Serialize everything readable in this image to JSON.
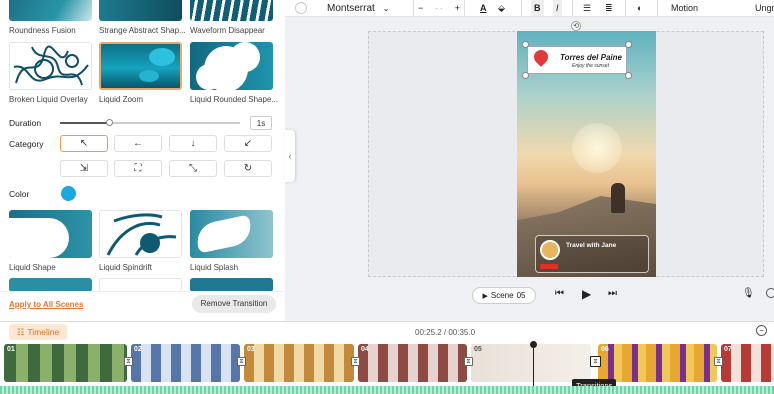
{
  "transitions": {
    "row1": [
      "Roundness Fusion",
      "Strange Abstract Shap...",
      "Waveform Disappear"
    ],
    "row2": [
      "Broken Liquid Overlay",
      "Liquid Zoom",
      "Liquid Rounded Shape..."
    ],
    "row3": [
      "Liquid Shape",
      "Liquid Spindrift",
      "Liquid Splash"
    ]
  },
  "duration": {
    "label": "Duration",
    "value": "1s",
    "fraction": 0.12
  },
  "category": {
    "label": "Category"
  },
  "color": {
    "label": "Color",
    "value": "#1aa8e0"
  },
  "actions": {
    "apply_all": "Apply to All Scenes",
    "remove": "Remove Transition"
  },
  "toolbar": {
    "font": "Montserrat",
    "size": "- -",
    "motion": "Motion",
    "group": "Ungr"
  },
  "preview": {
    "title": "Torres del Paine",
    "subtitle": "Enjoy the sunset",
    "badge": "Travel with Jane"
  },
  "player": {
    "scene_label": "Scene",
    "scene_number": "05"
  },
  "timeline": {
    "title": "Timeline",
    "time": "00:25.2 / 00:35.0",
    "clips": [
      "01",
      "02",
      "03",
      "04",
      "05",
      "06",
      "07"
    ],
    "tooltip": "Transitions"
  }
}
